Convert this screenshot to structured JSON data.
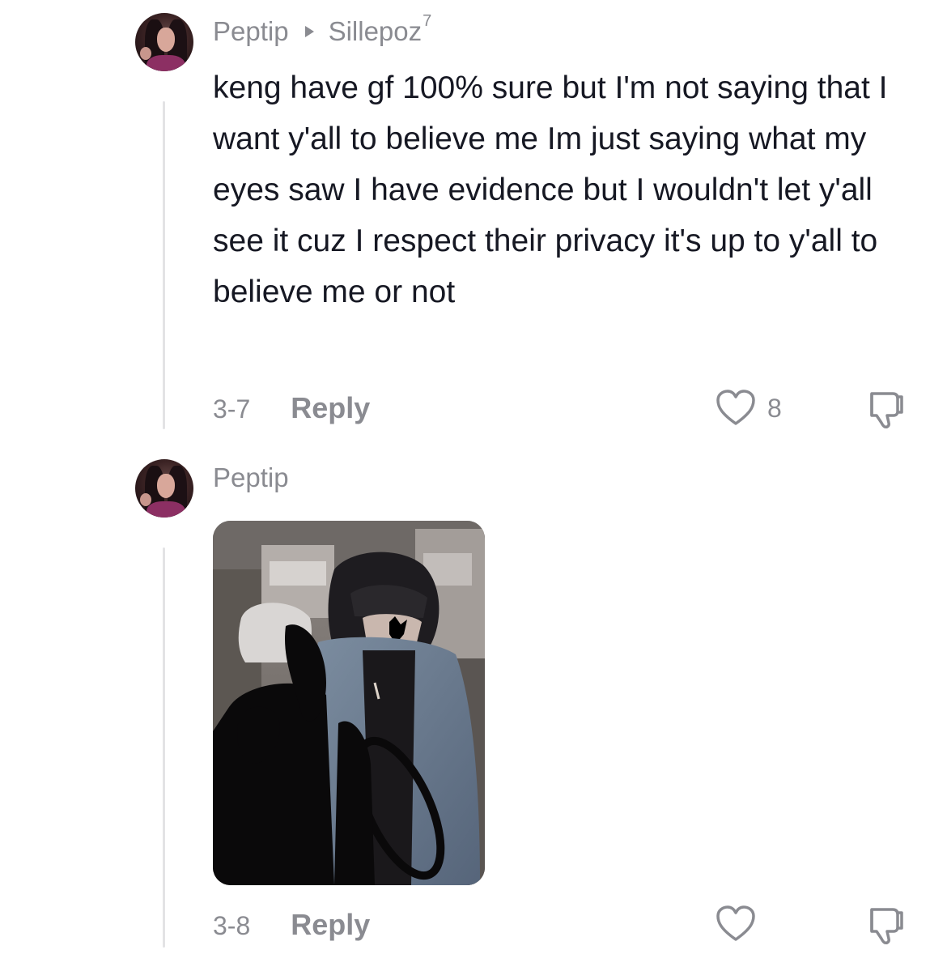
{
  "comments": [
    {
      "author": "Peptip",
      "reply_to": "Sillepoz",
      "reply_to_suffix": "7",
      "text": "keng have gf 100% sure but I'm not saying that I want y'all to believe me Im just saying what my eyes saw I have evidence but I wouldn't let y'all see it cuz I respect their privacy it's up to y'all to believe me or not",
      "date": "3-7",
      "reply_label": "Reply",
      "likes": "8"
    },
    {
      "author": "Peptip",
      "date": "3-8",
      "reply_label": "Reply"
    }
  ],
  "icons": {
    "like": "heart-outline-icon",
    "dislike": "thumbs-down-outline-icon",
    "reply_arrow": "triangle-right-icon"
  },
  "colors": {
    "text": "#161823",
    "secondary": "#8a8b91",
    "thread_line": "#e3e3e5"
  }
}
